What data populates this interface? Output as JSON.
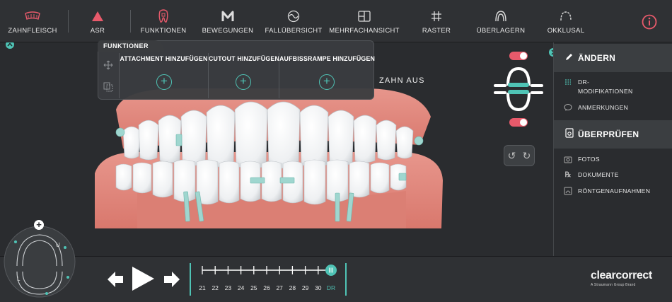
{
  "toolbar": {
    "items": [
      {
        "label": "ZAHNFLEISCH",
        "icon": "gum-icon"
      },
      {
        "label": "ASR",
        "icon": "asr-triangle-icon"
      },
      {
        "label": "FUNKTIONEN",
        "icon": "tooth-function-icon"
      },
      {
        "label": "BEWEGUNGEN",
        "icon": "movements-m-icon"
      },
      {
        "label": "FALLÜBERSICHT",
        "icon": "case-overview-icon"
      },
      {
        "label": "MEHRFACHANSICHT",
        "icon": "multi-view-icon"
      },
      {
        "label": "RASTER",
        "icon": "grid-icon"
      },
      {
        "label": "ÜBERLAGERN",
        "icon": "overlay-icon"
      },
      {
        "label": "OKKLUSAL",
        "icon": "occlusal-icon"
      }
    ],
    "info_icon": "info-icon",
    "accent_color": "#e85a6b"
  },
  "functions_panel": {
    "title": "FUNKTIONER",
    "columns": [
      {
        "label": "ATTACHMENT HINZUFÜGEN"
      },
      {
        "label": "CUTOUT HINZUFÜGEN"
      },
      {
        "label": "AUFBISSRAMPE HINZUFÜGEN"
      }
    ],
    "add_symbol": "+"
  },
  "viewport": {
    "tooth_off_label": "ZAHN AUS"
  },
  "sidebar": {
    "sections": [
      {
        "header": "ÄNDERN",
        "header_icon": "pencil-icon",
        "items": [
          {
            "label": "DR-MODIFIKATIONEN",
            "icon": "modifications-icon"
          },
          {
            "label": "ANMERKUNGEN",
            "icon": "comment-icon"
          }
        ]
      },
      {
        "header": "ÜBERPRÜFEN",
        "header_icon": "review-icon",
        "items": [
          {
            "label": "FOTOS",
            "icon": "camera-icon"
          },
          {
            "label": "DOKUMENTE",
            "icon": "rx-icon"
          },
          {
            "label": "RÖNTGENAUFNAHMEN",
            "icon": "xray-icon"
          }
        ]
      }
    ]
  },
  "navigator": {
    "upper_label": "U",
    "lower_label": "L",
    "add_symbol": "+"
  },
  "timeline": {
    "stages": [
      "21",
      "22",
      "23",
      "24",
      "25",
      "26",
      "27",
      "28",
      "29",
      "30",
      "DR"
    ],
    "current": "DR",
    "accent_color": "#4fc3b5"
  },
  "brand": {
    "name": "clearcorrect",
    "tagline": "A Straumann Group Brand"
  },
  "colors": {
    "teal": "#4fc3b5",
    "red": "#e85a6b",
    "gum": "#e2897f"
  }
}
